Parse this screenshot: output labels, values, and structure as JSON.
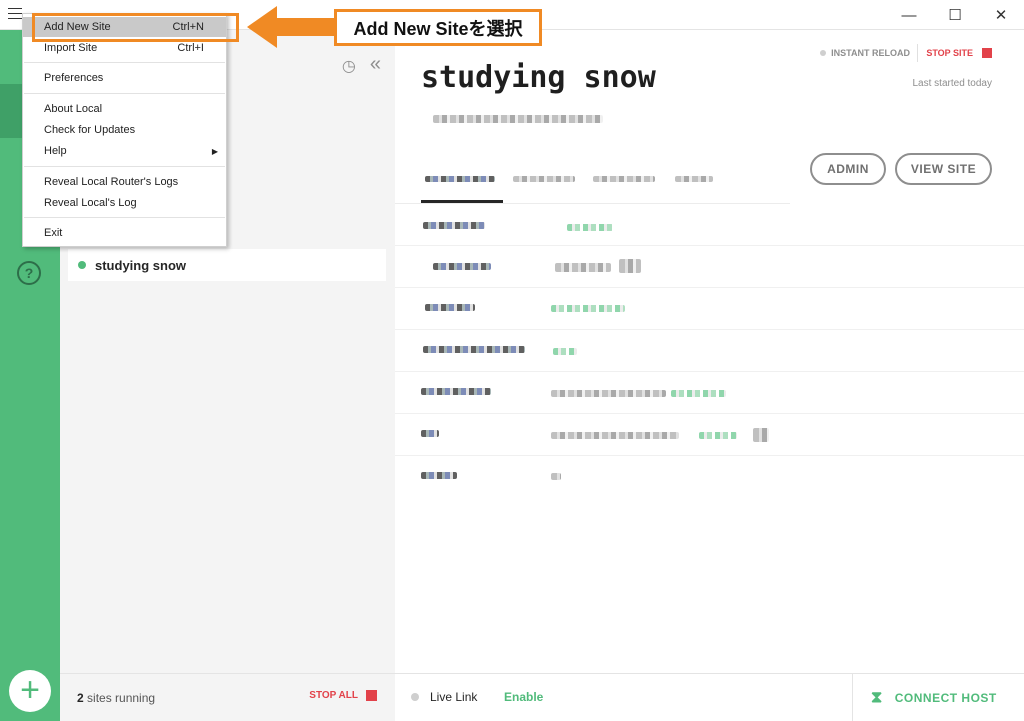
{
  "window": {
    "minimize_glyph": "—",
    "maximize_glyph": "☐",
    "close_glyph": "✕"
  },
  "menu": {
    "items": [
      {
        "label": "Add New Site",
        "shortcut": "Ctrl+N"
      },
      {
        "label": "Import Site",
        "shortcut": "Ctrl+I"
      },
      {
        "label": "Preferences",
        "shortcut": ""
      },
      {
        "label": "About Local",
        "shortcut": ""
      },
      {
        "label": "Check for Updates",
        "shortcut": ""
      },
      {
        "label": "Help",
        "shortcut": ""
      },
      {
        "label": "Reveal Local Router's Logs",
        "shortcut": ""
      },
      {
        "label": "Reveal Local's Log",
        "shortcut": ""
      },
      {
        "label": "Exit",
        "shortcut": ""
      }
    ],
    "help_arrow": "▶"
  },
  "annotation": {
    "label": "Add New Siteを選択",
    "color": "#f08a24"
  },
  "rail": {
    "help_glyph": "?",
    "add_glyph": "+"
  },
  "sites": {
    "history_glyph": "◷",
    "collapse_glyph": "«",
    "items": [
      {
        "name": "studying snow",
        "status": "running"
      }
    ],
    "footer": {
      "count": "2",
      "running_label": "sites running",
      "stop_all": "STOP ALL"
    }
  },
  "site": {
    "title": "studying snow",
    "instant_reload": "INSTANT RELOAD",
    "stop_site": "STOP SITE",
    "last_started": "Last started today",
    "admin_button": "ADMIN",
    "view_site_button": "VIEW SITE"
  },
  "footer": {
    "live_link": "Live Link",
    "enable": "Enable",
    "connect_host": "CONNECT HOST",
    "connect_glyph": "⧗"
  },
  "colors": {
    "brand_green": "#51bb7b",
    "stop_red": "#e2424a",
    "accent_orange": "#f08a24"
  }
}
